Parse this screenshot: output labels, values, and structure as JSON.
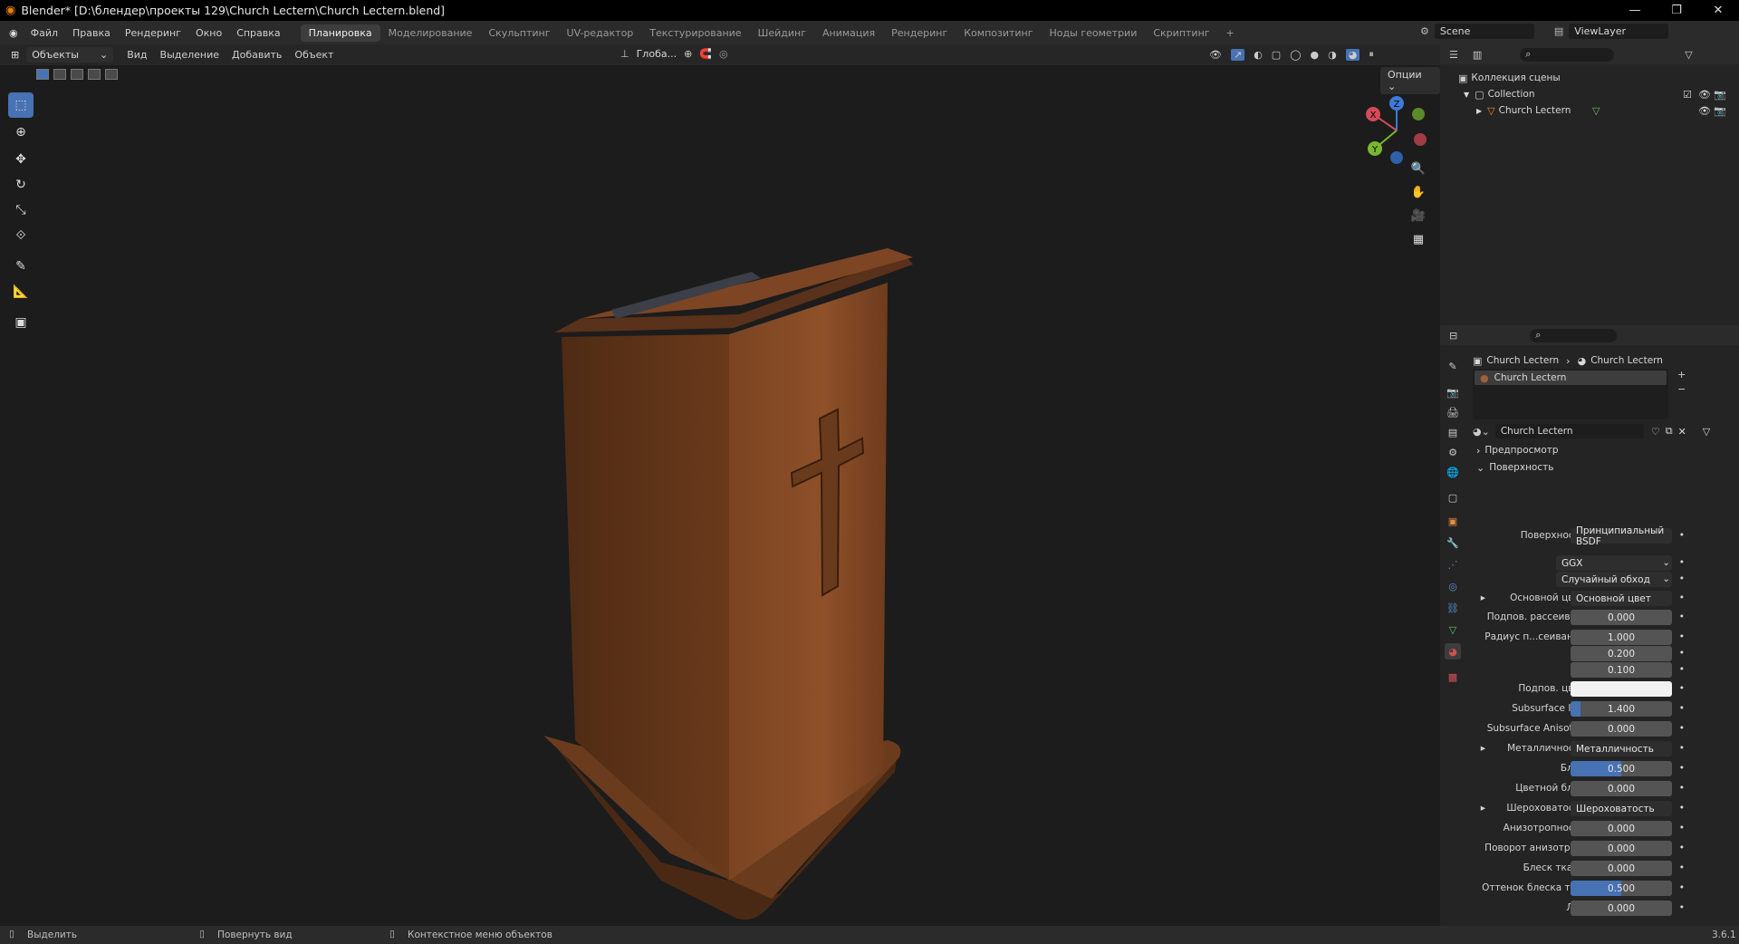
{
  "window": {
    "title": "Blender* [D:\\блендер\\проекты 129\\Church Lectern\\Church Lectern.blend]"
  },
  "menu": [
    "Файл",
    "Правка",
    "Рендеринг",
    "Окно",
    "Справка"
  ],
  "workspaces": [
    "Планировка",
    "Моделирование",
    "Скульптинг",
    "UV-редактор",
    "Текстурирование",
    "Шейдинг",
    "Анимация",
    "Рендеринг",
    "Композитинг",
    "Ноды геометрии",
    "Скриптинг"
  ],
  "active_workspace": "Планировка",
  "scene": "Scene",
  "viewlayer": "ViewLayer",
  "viewport_header": {
    "mode": "Объекты",
    "menus": [
      "Вид",
      "Выделение",
      "Добавить",
      "Объект"
    ],
    "transform_orientation": "Глоба...",
    "options": "Опции"
  },
  "gizmo": {
    "x": "X",
    "y": "Y",
    "z": "Z"
  },
  "outliner": {
    "root": "Коллекция сцены",
    "collection": "Collection",
    "object": "Church Lectern"
  },
  "properties": {
    "breadcrumb": [
      "Church Lectern",
      "Church Lectern"
    ],
    "slot": "Church Lectern",
    "material_name": "Church Lectern",
    "panels": {
      "preview": "Предпросмотр",
      "surface": "Поверхность"
    },
    "rows": [
      {
        "label": "Поверхность",
        "value": "Принципиальный BSDF",
        "kind": "link"
      },
      {
        "label": "",
        "value": "GGX",
        "kind": "select"
      },
      {
        "label": "",
        "value": "Случайный обход",
        "kind": "select"
      },
      {
        "label": "Основной цвет",
        "value": "Основной цвет",
        "kind": "link"
      },
      {
        "label": "Подпов. рассеива...",
        "value": "0.000",
        "kind": "num"
      },
      {
        "label": "Радиус п...сеивания",
        "value": "1.000",
        "kind": "num"
      },
      {
        "label": "",
        "value": "0.200",
        "kind": "num"
      },
      {
        "label": "",
        "value": "0.100",
        "kind": "num"
      },
      {
        "label": "Подпов. цвет",
        "value": "",
        "kind": "color"
      },
      {
        "label": "Subsurface IOR",
        "value": "1.400",
        "kind": "num"
      },
      {
        "label": "Subsurface Anisotr...",
        "value": "0.000",
        "kind": "num"
      },
      {
        "label": "Металличность",
        "value": "Металличность",
        "kind": "link"
      },
      {
        "label": "Блик",
        "value": "0.500",
        "kind": "slider"
      },
      {
        "label": "Цветной блик",
        "value": "0.000",
        "kind": "num"
      },
      {
        "label": "Шероховатость",
        "value": "Шероховатость",
        "kind": "link"
      },
      {
        "label": "Анизотропность",
        "value": "0.000",
        "kind": "num"
      },
      {
        "label": "Поворот анизотро...",
        "value": "0.000",
        "kind": "num"
      },
      {
        "label": "Блеск ткани",
        "value": "0.000",
        "kind": "num"
      },
      {
        "label": "Оттенок блеска тк...",
        "value": "0.500",
        "kind": "slider"
      },
      {
        "label": "Лак",
        "value": "0.000",
        "kind": "num"
      }
    ]
  },
  "statusbar": {
    "select": "Выделить",
    "rotate": "Повернуть вид",
    "context": "Контекстное меню объектов",
    "version": "3.6.1"
  }
}
